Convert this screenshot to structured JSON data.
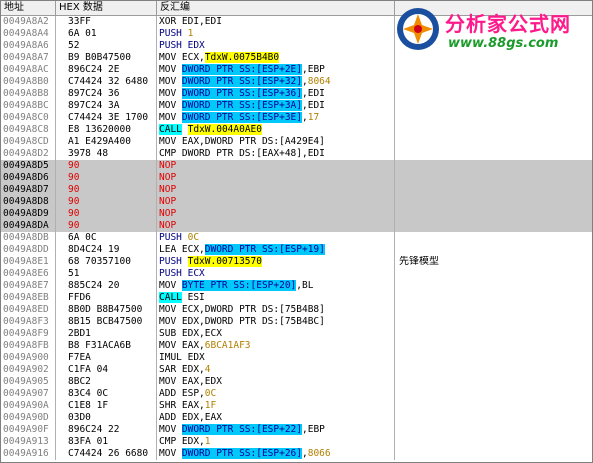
{
  "columns": {
    "address": "地址",
    "hex": "HEX 数据",
    "disasm": "反汇编",
    "comment": ""
  },
  "watermark": {
    "title": "分析家公式网",
    "url": "www.88gs.com"
  },
  "rows": [
    {
      "addr": "0049A8A2",
      "hex": "33FF",
      "dis": [
        {
          "t": "XOR EDI,EDI"
        }
      ]
    },
    {
      "addr": "0049A8A4",
      "hex": "6A 01",
      "dis": [
        {
          "t": "PUSH ",
          "c": "blue"
        },
        {
          "t": "1",
          "c": "num"
        }
      ]
    },
    {
      "addr": "0049A8A6",
      "hex": "52",
      "dis": [
        {
          "t": "PUSH EDX",
          "c": "blue"
        }
      ]
    },
    {
      "addr": "0049A8A7",
      "hex": "B9 B0B47500",
      "dis": [
        {
          "t": "MOV ECX,"
        },
        {
          "t": "TdxW.0075B4B0",
          "c": "hl-yellow"
        }
      ]
    },
    {
      "addr": "0049A8AC",
      "hex": "896C24 2E",
      "dis": [
        {
          "t": "MOV "
        },
        {
          "t": "DWORD PTR SS:[ESP+2E]",
          "c": "hl-cyan"
        },
        {
          "t": ",EBP"
        }
      ]
    },
    {
      "addr": "0049A8B0",
      "hex": "C74424 32 6480",
      "dis": [
        {
          "t": "MOV "
        },
        {
          "t": "DWORD PTR SS:[ESP+32]",
          "c": "hl-cyan"
        },
        {
          "t": ","
        },
        {
          "t": "8064",
          "c": "num"
        }
      ]
    },
    {
      "addr": "0049A8B8",
      "hex": "897C24 36",
      "dis": [
        {
          "t": "MOV "
        },
        {
          "t": "DWORD PTR SS:[ESP+36]",
          "c": "hl-cyan"
        },
        {
          "t": ",EDI"
        }
      ]
    },
    {
      "addr": "0049A8BC",
      "hex": "897C24 3A",
      "dis": [
        {
          "t": "MOV "
        },
        {
          "t": "DWORD PTR SS:[ESP+3A]",
          "c": "hl-cyan"
        },
        {
          "t": ",EDI"
        }
      ]
    },
    {
      "addr": "0049A8C0",
      "hex": "C74424 3E 1700",
      "dis": [
        {
          "t": "MOV "
        },
        {
          "t": "DWORD PTR SS:[ESP+3E]",
          "c": "hl-cyan"
        },
        {
          "t": ","
        },
        {
          "t": "17",
          "c": "num"
        }
      ]
    },
    {
      "addr": "0049A8C8",
      "hex": "E8 13620000",
      "dis": [
        {
          "t": "CALL",
          "c": "hl-call"
        },
        {
          "t": " "
        },
        {
          "t": "TdxW.004A0AE0",
          "c": "hl-yellow"
        }
      ]
    },
    {
      "addr": "0049A8CD",
      "hex": "A1 E429A400",
      "dis": [
        {
          "t": "MOV EAX,DWORD PTR DS:[A429E4]"
        }
      ]
    },
    {
      "addr": "0049A8D2",
      "hex": "3978 48",
      "dis": [
        {
          "t": "CMP DWORD PTR DS:[EAX+48],EDI"
        }
      ]
    },
    {
      "addr": "0049A8D5",
      "hex": "90",
      "dis": [
        {
          "t": "NOP"
        }
      ],
      "sel": true,
      "red": true
    },
    {
      "addr": "0049A8D6",
      "hex": "90",
      "dis": [
        {
          "t": "NOP"
        }
      ],
      "sel": true,
      "red": true
    },
    {
      "addr": "0049A8D7",
      "hex": "90",
      "dis": [
        {
          "t": "NOP"
        }
      ],
      "sel": true,
      "red": true
    },
    {
      "addr": "0049A8D8",
      "hex": "90",
      "dis": [
        {
          "t": "NOP"
        }
      ],
      "sel": true,
      "red": true
    },
    {
      "addr": "0049A8D9",
      "hex": "90",
      "dis": [
        {
          "t": "NOP"
        }
      ],
      "sel": true,
      "red": true
    },
    {
      "addr": "0049A8DA",
      "hex": "90",
      "dis": [
        {
          "t": "NOP"
        }
      ],
      "sel": true,
      "red": true
    },
    {
      "addr": "0049A8DB",
      "hex": "6A 0C",
      "dis": [
        {
          "t": "PUSH ",
          "c": "blue"
        },
        {
          "t": "0C",
          "c": "num"
        }
      ]
    },
    {
      "addr": "0049A8DD",
      "hex": "8D4C24 19",
      "dis": [
        {
          "t": "LEA ECX,"
        },
        {
          "t": "DWORD PTR SS:[ESP+19]",
          "c": "hl-cyan"
        }
      ]
    },
    {
      "addr": "0049A8E1",
      "hex": "68 70357100",
      "dis": [
        {
          "t": "PUSH ",
          "c": "blue"
        },
        {
          "t": "TdxW.00713570",
          "c": "hl-yellow"
        }
      ],
      "comment": "先锋模型"
    },
    {
      "addr": "0049A8E6",
      "hex": "51",
      "dis": [
        {
          "t": "PUSH ECX",
          "c": "blue"
        }
      ]
    },
    {
      "addr": "0049A8E7",
      "hex": "885C24 20",
      "dis": [
        {
          "t": "MOV "
        },
        {
          "t": "BYTE PTR SS:[ESP+20]",
          "c": "hl-cyan"
        },
        {
          "t": ",BL"
        }
      ]
    },
    {
      "addr": "0049A8EB",
      "hex": "FFD6",
      "dis": [
        {
          "t": "CALL",
          "c": "hl-call"
        },
        {
          "t": " ESI"
        }
      ]
    },
    {
      "addr": "0049A8ED",
      "hex": "8B0D B8B47500",
      "dis": [
        {
          "t": "MOV ECX,DWORD PTR DS:[75B4B8]"
        }
      ]
    },
    {
      "addr": "0049A8F3",
      "hex": "8B15 BCB47500",
      "dis": [
        {
          "t": "MOV EDX,DWORD PTR DS:[75B4BC]"
        }
      ]
    },
    {
      "addr": "0049A8F9",
      "hex": "2BD1",
      "dis": [
        {
          "t": "SUB EDX,ECX"
        }
      ]
    },
    {
      "addr": "0049A8FB",
      "hex": "B8 F31ACA6B",
      "dis": [
        {
          "t": "MOV EAX,"
        },
        {
          "t": "6BCA1AF3",
          "c": "num"
        }
      ]
    },
    {
      "addr": "0049A900",
      "hex": "F7EA",
      "dis": [
        {
          "t": "IMUL EDX"
        }
      ]
    },
    {
      "addr": "0049A902",
      "hex": "C1FA 04",
      "dis": [
        {
          "t": "SAR EDX,"
        },
        {
          "t": "4",
          "c": "num"
        }
      ]
    },
    {
      "addr": "0049A905",
      "hex": "8BC2",
      "dis": [
        {
          "t": "MOV EAX,EDX"
        }
      ]
    },
    {
      "addr": "0049A907",
      "hex": "83C4 0C",
      "dis": [
        {
          "t": "ADD ESP,"
        },
        {
          "t": "0C",
          "c": "num"
        }
      ]
    },
    {
      "addr": "0049A90A",
      "hex": "C1E8 1F",
      "dis": [
        {
          "t": "SHR EAX,"
        },
        {
          "t": "1F",
          "c": "num"
        }
      ]
    },
    {
      "addr": "0049A90D",
      "hex": "03D0",
      "dis": [
        {
          "t": "ADD EDX,EAX"
        }
      ]
    },
    {
      "addr": "0049A90F",
      "hex": "896C24 22",
      "dis": [
        {
          "t": "MOV "
        },
        {
          "t": "DWORD PTR SS:[ESP+22]",
          "c": "hl-cyan"
        },
        {
          "t": ",EBP"
        }
      ]
    },
    {
      "addr": "0049A913",
      "hex": "83FA 01",
      "dis": [
        {
          "t": "CMP EDX,"
        },
        {
          "t": "1",
          "c": "num"
        }
      ]
    },
    {
      "addr": "0049A916",
      "hex": "C74424 26 6680",
      "dis": [
        {
          "t": "MOV "
        },
        {
          "t": "DWORD PTR SS:[ESP+26]",
          "c": "hl-cyan"
        },
        {
          "t": ","
        },
        {
          "t": "8066",
          "c": "num"
        }
      ]
    }
  ]
}
